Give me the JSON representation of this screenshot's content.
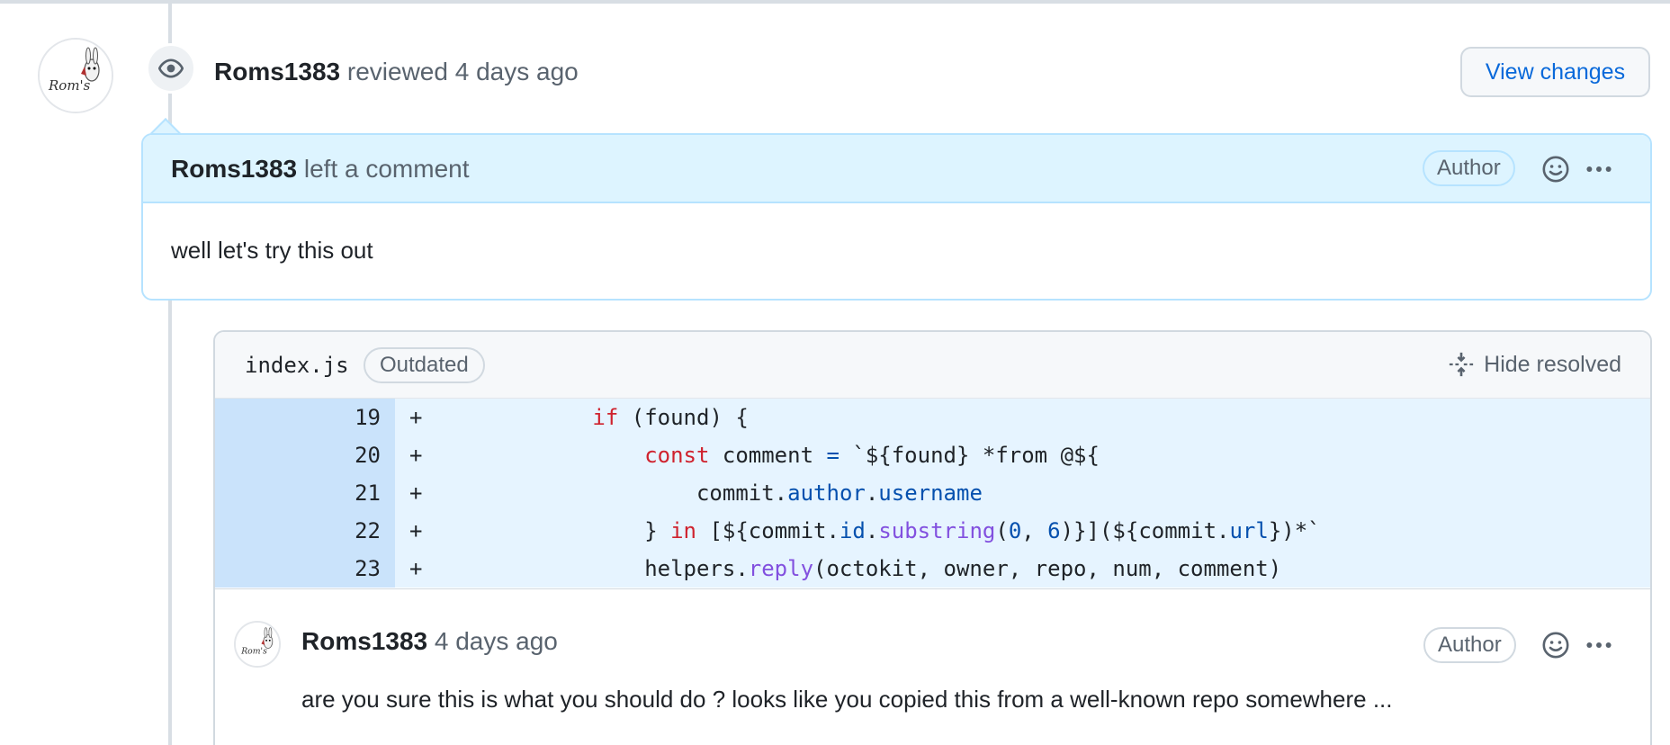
{
  "review": {
    "author": "Roms1383",
    "action": "reviewed",
    "time": "4 days ago",
    "view_changes_label": "View changes"
  },
  "comment": {
    "author": "Roms1383",
    "action": "left a comment",
    "badge": "Author",
    "body": "well let's try this out"
  },
  "thread": {
    "file_name": "index.js",
    "status_badge": "Outdated",
    "hide_resolved_label": "Hide resolved",
    "diff_lines": [
      {
        "num": "19",
        "sign": "+",
        "code": "            if (found) {"
      },
      {
        "num": "20",
        "sign": "+",
        "code": "                const comment = `${found} *from @${"
      },
      {
        "num": "21",
        "sign": "+",
        "code": "                    commit.author.username"
      },
      {
        "num": "22",
        "sign": "+",
        "code": "                } in [${commit.id.substring(0, 6)}](${commit.url})*`"
      },
      {
        "num": "23",
        "sign": "+",
        "code": "                helpers.reply(octokit, owner, repo, num, comment)"
      }
    ],
    "reply": {
      "author": "Roms1383",
      "time": "4 days ago",
      "badge": "Author",
      "body": "are you sure this is what you should do ? looks like you copied this from a well-known repo somewhere ..."
    }
  },
  "icons": {
    "eye": "eye-icon",
    "smiley": "smiley-icon",
    "kebab": "kebab-horizontal-icon",
    "fold": "fold-icon"
  },
  "colors": {
    "link": "#0969da",
    "comment_header_bg": "#ddf4ff",
    "diff_line_bg": "#e6f4ff",
    "diff_num_bg": "#cae3fb",
    "keyword": "#cf222e",
    "property": "#0550ae",
    "function": "#8250df"
  }
}
